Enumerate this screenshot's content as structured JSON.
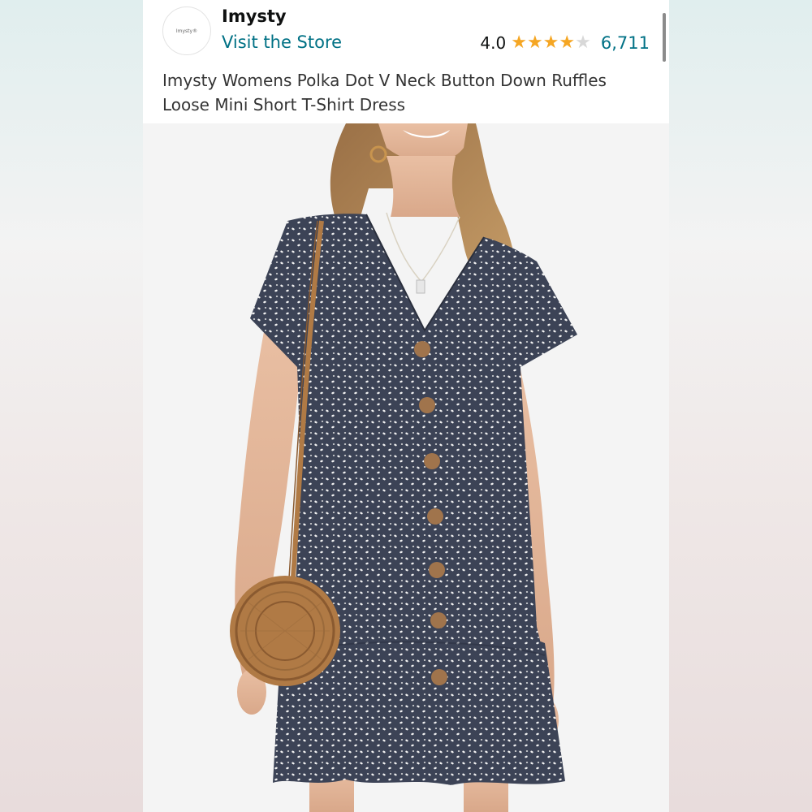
{
  "store": {
    "logo_text": "Imysty®",
    "brand_name": "Imysty",
    "visit_store_label": "Visit the Store"
  },
  "rating": {
    "value": "4.0",
    "stars_filled": 4,
    "stars_total": 5,
    "review_count": "6,711"
  },
  "product": {
    "title": "Imysty Womens Polka Dot V Neck Button Down Ruffles Loose Mini Short T-Shirt Dress"
  },
  "colors": {
    "link": "#007185",
    "star": "#f5a623",
    "dress": "#3c4356",
    "button": "#a0744c",
    "bag": "#b07a45"
  }
}
